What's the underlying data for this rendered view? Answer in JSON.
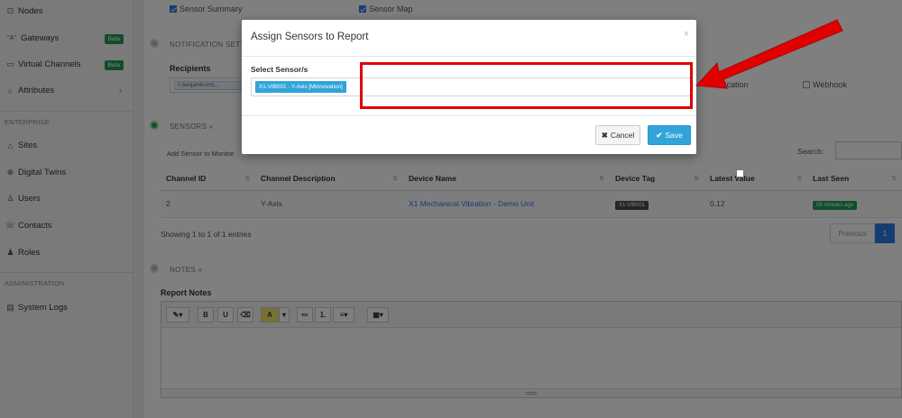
{
  "sidebar": {
    "items": [
      {
        "label": "Nodes",
        "icon": "nodes-icon"
      },
      {
        "label": "Gateways",
        "icon": "gateway-icon",
        "badge": "Beta"
      },
      {
        "label": "Virtual Channels",
        "icon": "virtual-channels-icon",
        "badge": "Beta"
      },
      {
        "label": "Attributes",
        "icon": "attributes-icon"
      },
      {
        "label": "Sites",
        "icon": "sites-icon"
      },
      {
        "label": "Digital Twins",
        "icon": "digital-twins-icon"
      },
      {
        "label": "Users",
        "icon": "users-icon"
      },
      {
        "label": "Contacts",
        "icon": "contacts-icon"
      },
      {
        "label": "Roles",
        "icon": "roles-icon"
      },
      {
        "label": "System Logs",
        "icon": "system-logs-icon"
      }
    ],
    "sections": {
      "enterprise": "ENTERPRISE",
      "administration": "ADMINISTRATION"
    },
    "gateway_prefix": "\"A\""
  },
  "report": {
    "options": {
      "sensor_summary": "Sensor Summary",
      "sensor_map": "Sensor Map"
    },
    "notification_title": "NOTIFICATION SETTIN",
    "recipients_label": "Recipients",
    "recipient_tag": "× benjamin.mcl...",
    "notification_label": "Notification",
    "webhook_label": "Webhook",
    "sensors_title": "SENSORS",
    "collapse_symbol": "«",
    "add_sensor_label": "Add Sensor to Monitor",
    "search_label": "Search:",
    "table": {
      "headers": [
        "Channel ID",
        "Channel Description",
        "Device Name",
        "Device Tag",
        "Latest Value",
        "Last Seen"
      ],
      "rows": [
        {
          "channel_id": "2",
          "description": "Y-Axis",
          "device": "X1 Mechanical Vibration - Demo Unit",
          "tag": "X1-VIB001",
          "value": "0.12",
          "last_seen": "58 minutes ago"
        }
      ],
      "info": "Showing 1 to 1 of 1 entries",
      "prev": "Previous",
      "page": "1"
    },
    "notes_title": "NOTES",
    "notes_label": "Report Notes"
  },
  "modal": {
    "title": "Assign Sensors to Report",
    "close": "×",
    "select_label": "Select Sensor/s",
    "selected_tag": "X1-VIB001 - Y-Axis [Minnovation]",
    "cancel": "Cancel",
    "save": "Save"
  },
  "colors": {
    "accent": "#31a4d9",
    "annotation": "#e00000",
    "beta": "#1f9d55"
  }
}
